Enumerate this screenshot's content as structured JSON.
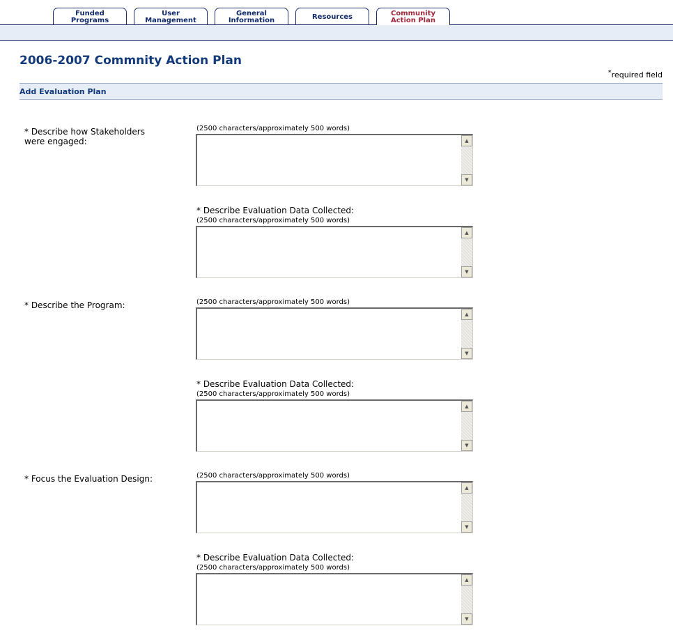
{
  "tabs": [
    {
      "label": "Funded\nPrograms"
    },
    {
      "label": "User\nManagement"
    },
    {
      "label": "General\nInformation"
    },
    {
      "label": "Resources"
    },
    {
      "label": "Community\nAction Plan"
    }
  ],
  "page_title": "2006-2007 Commnity Action Plan",
  "required_note": {
    "marker": "*",
    "text": "required field"
  },
  "section_title": "Add Evaluation Plan",
  "hint_text": "(2500 characters/approximately 500 words)",
  "questions": [
    {
      "label": "* Describe how Stakeholders were engaged:",
      "sub_label": "* Describe Evaluation Data Collected:"
    },
    {
      "label": "* Describe the Program:",
      "sub_label": "* Describe Evaluation Data Collected:"
    },
    {
      "label": "* Focus the Evaluation Design:",
      "sub_label": "* Describe Evaluation Data Collected:"
    }
  ],
  "icons": {
    "scroll_up": "scroll-up-arrow-icon",
    "scroll_down": "scroll-down-arrow-icon"
  },
  "colors": {
    "title": "#123a7a",
    "active_tab": "#a0283c",
    "band": "#e6edf7"
  }
}
